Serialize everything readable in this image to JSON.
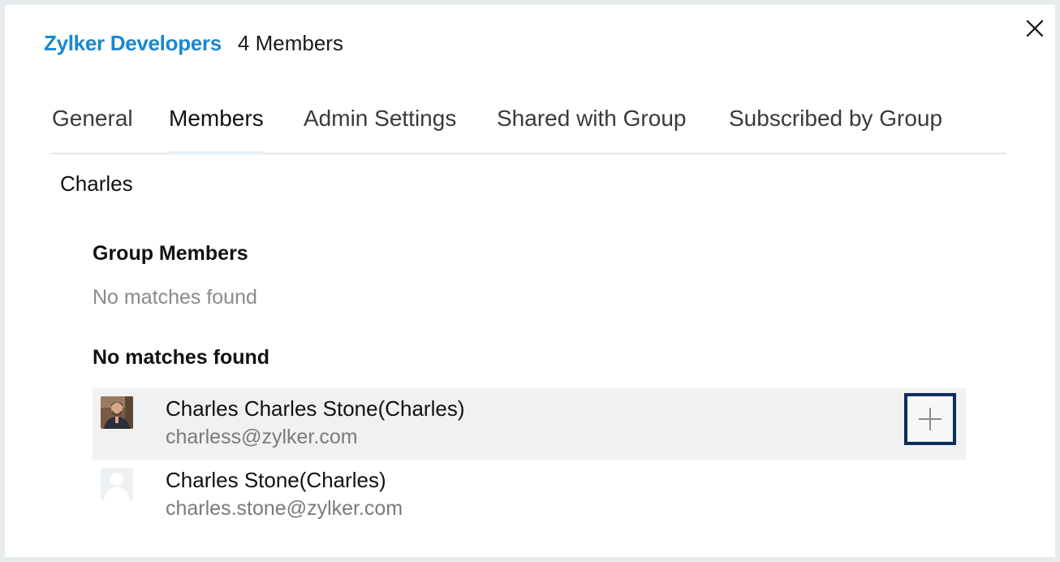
{
  "header": {
    "group_name": "Zylker Developers",
    "member_count": "4 Members"
  },
  "tabs": [
    {
      "label": "General",
      "active": false
    },
    {
      "label": "Members",
      "active": true
    },
    {
      "label": "Admin Settings",
      "active": false
    },
    {
      "label": "Shared with Group",
      "active": false
    },
    {
      "label": "Subscribed by Group",
      "active": false
    }
  ],
  "search": {
    "value": "Charles"
  },
  "group_members": {
    "heading": "Group Members",
    "empty_text": "No matches found"
  },
  "other_results": {
    "heading": "No matches found",
    "users": [
      {
        "name": "Charles Charles Stone(Charles)",
        "email": "charless@zylker.com",
        "avatar": "photo-avatar",
        "highlighted": true,
        "add_icon": "plus-icon"
      },
      {
        "name": "Charles Stone(Charles)",
        "email": "charles.stone@zylker.com",
        "avatar": "placeholder-avatar",
        "highlighted": false
      }
    ]
  },
  "colors": {
    "brand": "#1a87d0",
    "focus_border": "#0b2d5e",
    "row_highlight": "#f1f1f1"
  }
}
